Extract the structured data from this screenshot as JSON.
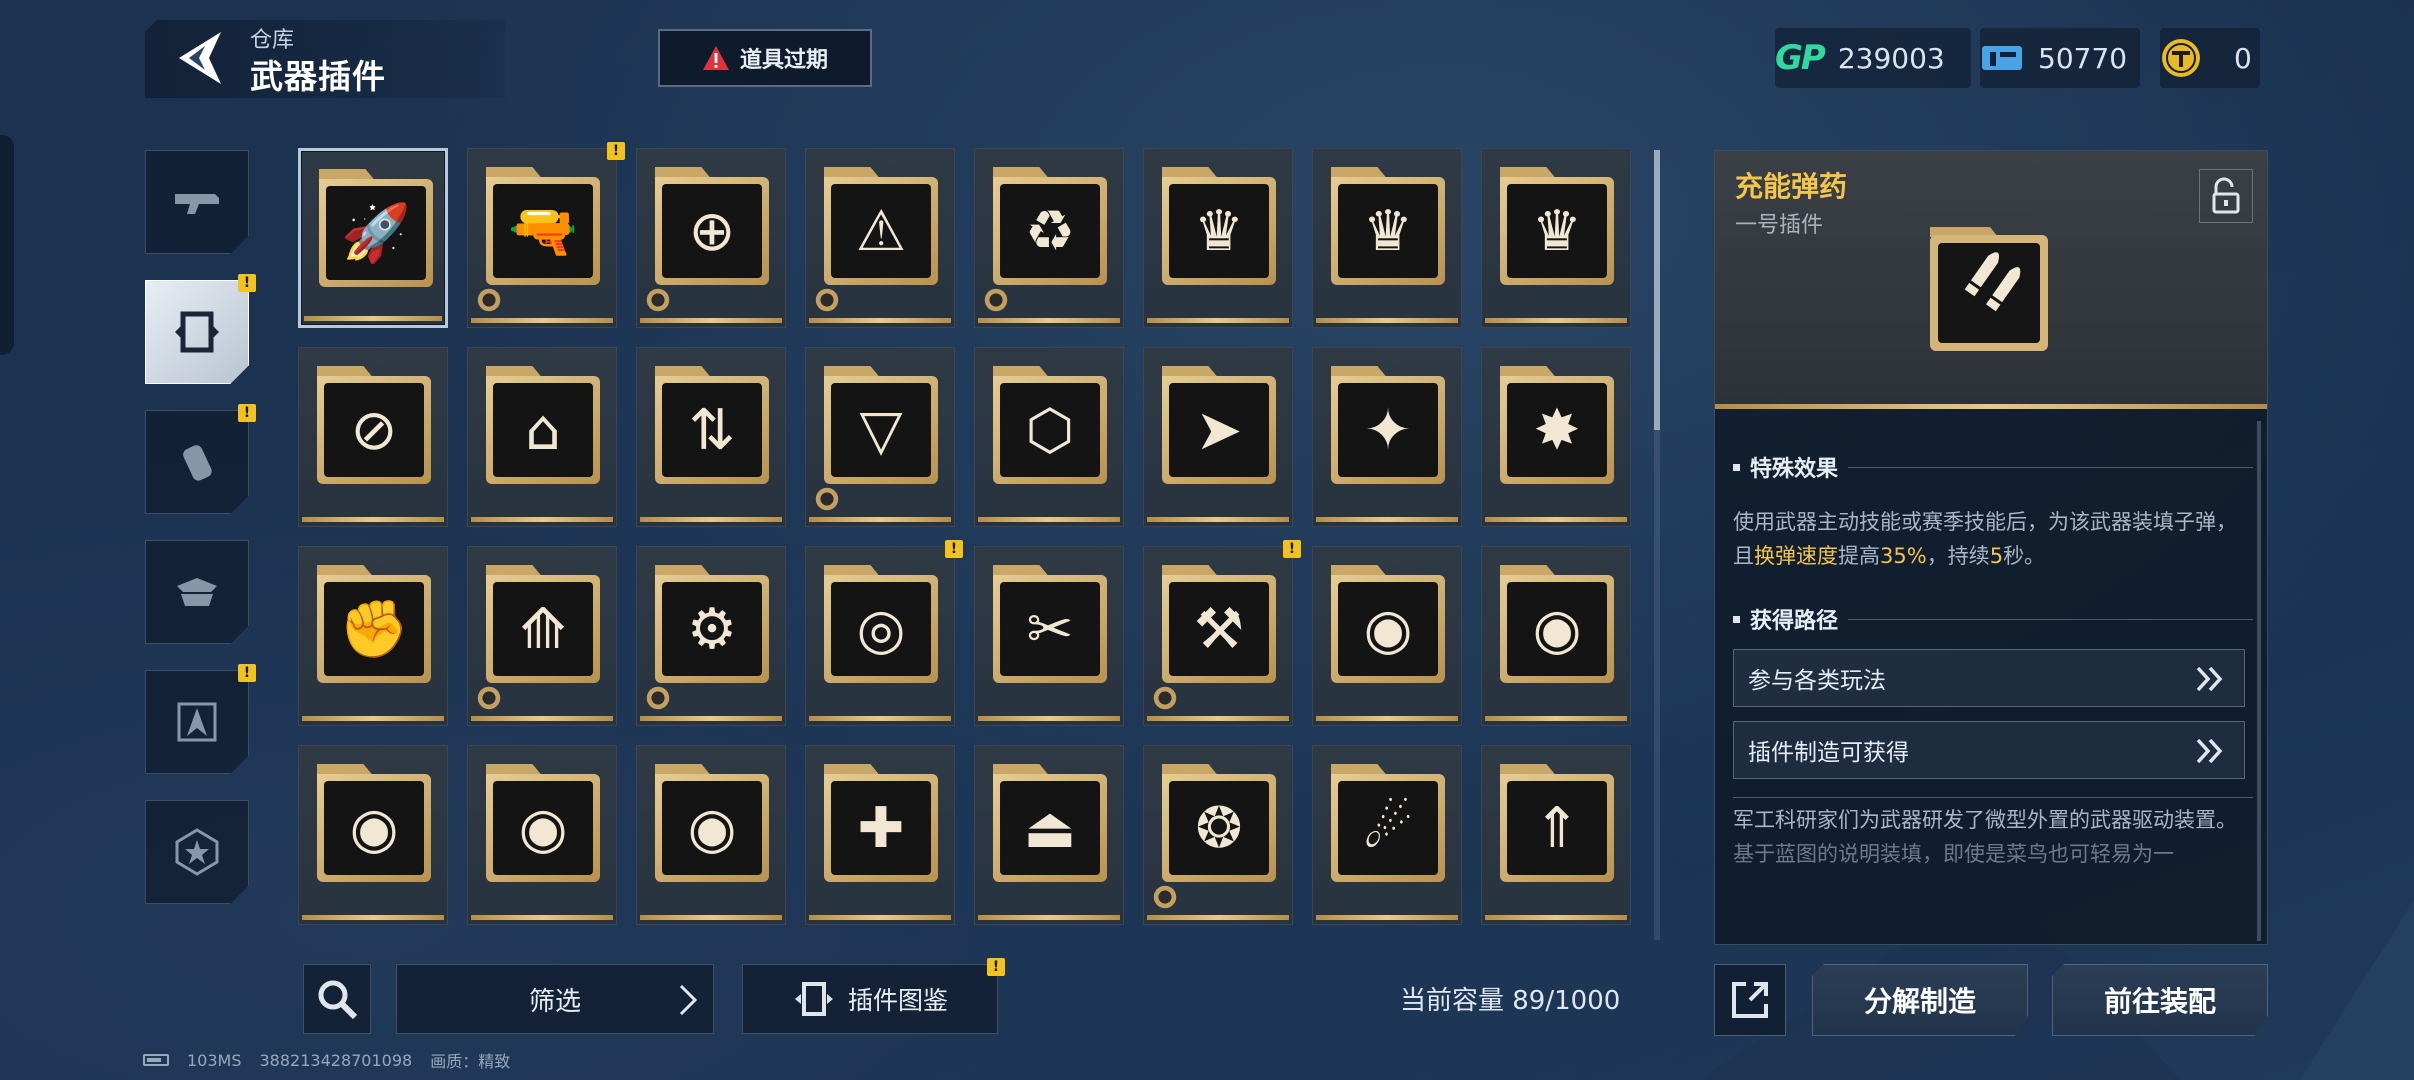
{
  "header": {
    "breadcrumb": "仓库",
    "title": "武器插件",
    "notice": "道具过期"
  },
  "currencies": [
    {
      "name": "gp",
      "logo": "GP",
      "value": "239003"
    },
    {
      "name": "ticket",
      "icon": "ticket-icon",
      "value": "50770"
    },
    {
      "name": "coin",
      "icon": "gold-coin-icon",
      "value": "0"
    }
  ],
  "categories": [
    {
      "icon": "gun-icon",
      "active": false,
      "badge": false
    },
    {
      "icon": "plugin-chip-icon",
      "active": true,
      "badge": true
    },
    {
      "icon": "grenade-icon",
      "active": false,
      "badge": true
    },
    {
      "icon": "armor-icon",
      "active": false,
      "badge": false
    },
    {
      "icon": "compass-icon",
      "active": false,
      "badge": true
    },
    {
      "icon": "star-badge-icon",
      "active": false,
      "badge": false
    }
  ],
  "badge_mark": "!",
  "grid": {
    "selected_index": 0,
    "items": [
      {
        "glyph": "🚀",
        "gear": false,
        "badge": false
      },
      {
        "glyph": "🔫",
        "gear": true,
        "badge": true
      },
      {
        "glyph": "⊕",
        "gear": true,
        "badge": false
      },
      {
        "glyph": "⚠",
        "gear": true,
        "badge": false
      },
      {
        "glyph": "♻",
        "gear": true,
        "badge": false
      },
      {
        "glyph": "♛",
        "gear": false,
        "badge": false
      },
      {
        "glyph": "♛",
        "gear": false,
        "badge": false
      },
      {
        "glyph": "♛",
        "gear": false,
        "badge": false
      },
      {
        "glyph": "⊘",
        "gear": false,
        "badge": false
      },
      {
        "glyph": "⌂",
        "gear": false,
        "badge": false
      },
      {
        "glyph": "⇅",
        "gear": false,
        "badge": false
      },
      {
        "glyph": "▽",
        "gear": true,
        "badge": false
      },
      {
        "glyph": "⬡",
        "gear": false,
        "badge": false
      },
      {
        "glyph": "➤",
        "gear": false,
        "badge": false
      },
      {
        "glyph": "✦",
        "gear": false,
        "badge": false
      },
      {
        "glyph": "✸",
        "gear": false,
        "badge": false
      },
      {
        "glyph": "✊",
        "gear": false,
        "badge": false
      },
      {
        "glyph": "⟰",
        "gear": true,
        "badge": false
      },
      {
        "glyph": "⚙",
        "gear": true,
        "badge": false
      },
      {
        "glyph": "◎",
        "gear": false,
        "badge": true
      },
      {
        "glyph": "✂",
        "gear": false,
        "badge": false
      },
      {
        "glyph": "⚒",
        "gear": true,
        "badge": true
      },
      {
        "glyph": "◉",
        "gear": false,
        "badge": false
      },
      {
        "glyph": "◉",
        "gear": false,
        "badge": false
      },
      {
        "glyph": "◉",
        "gear": false,
        "badge": false
      },
      {
        "glyph": "◉",
        "gear": false,
        "badge": false
      },
      {
        "glyph": "◉",
        "gear": false,
        "badge": false
      },
      {
        "glyph": "✚",
        "gear": false,
        "badge": false
      },
      {
        "glyph": "⏏",
        "gear": false,
        "badge": false
      },
      {
        "glyph": "❂",
        "gear": true,
        "badge": false
      },
      {
        "glyph": "☄",
        "gear": false,
        "badge": false
      },
      {
        "glyph": "⇑",
        "gear": false,
        "badge": false
      }
    ]
  },
  "bottom": {
    "filter_label": "筛选",
    "codex_label": "插件图鉴",
    "capacity": "当前容量 89/1000"
  },
  "status": {
    "ping": "103MS",
    "uid": "388213428701098",
    "quality": "画质：精致"
  },
  "detail": {
    "name": "充能弹药",
    "type": "一号插件",
    "effect_title": "特殊效果",
    "effect_parts": [
      "使用武器主动技能或赛季技能后，为该武器装填子弹，且",
      "换弹速度",
      "提高",
      "35%",
      "，持续",
      "5",
      "秒。"
    ],
    "route_title": "获得路径",
    "routes": [
      "参与各类玩法",
      "插件制造可获得"
    ],
    "lore": "军工科研家们为武器研发了微型外置的武器驱动装置。",
    "lore_faded": "基于蓝图的说明装填，即使是菜鸟也可轻易为一"
  },
  "actions": {
    "disassemble": "分解制造",
    "equip": "前往装配"
  },
  "colors": {
    "accent_gold": "#f3c54a",
    "gp_green": "#2fd9a0",
    "badge_yellow": "#f2c31e",
    "warning_red": "#e0343c"
  }
}
